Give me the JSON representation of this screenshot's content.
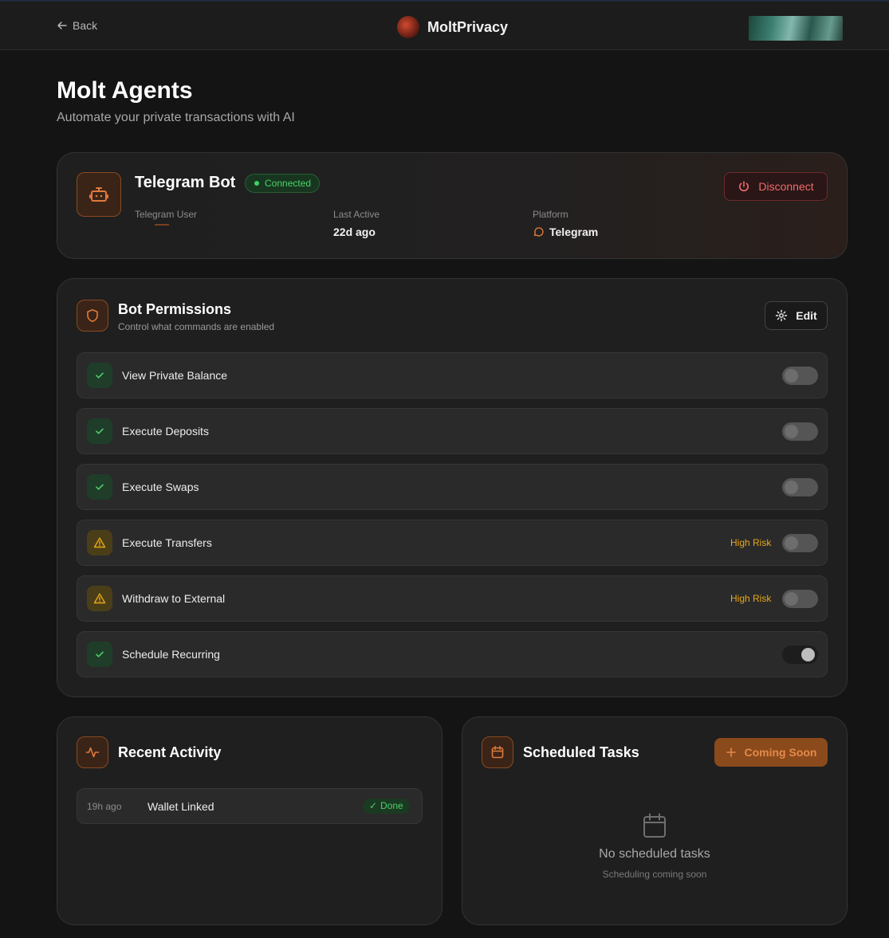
{
  "header": {
    "back_label": "Back",
    "brand": "MoltPrivacy"
  },
  "page": {
    "title": "Molt Agents",
    "subtitle": "Automate your private transactions with AI"
  },
  "bot": {
    "title": "Telegram Bot",
    "status": "Connected",
    "disconnect_label": "Disconnect",
    "user_label": "Telegram User",
    "last_active_label": "Last Active",
    "last_active_value": "22d ago",
    "platform_label": "Platform",
    "platform_value": "Telegram"
  },
  "permissions": {
    "title": "Bot Permissions",
    "subtitle": "Control what commands are enabled",
    "edit_label": "Edit",
    "items": [
      {
        "label": "View Private Balance",
        "risk": "",
        "enabled": false,
        "kind": "ok"
      },
      {
        "label": "Execute Deposits",
        "risk": "",
        "enabled": false,
        "kind": "ok"
      },
      {
        "label": "Execute Swaps",
        "risk": "",
        "enabled": false,
        "kind": "ok"
      },
      {
        "label": "Execute Transfers",
        "risk": "High Risk",
        "enabled": false,
        "kind": "warn"
      },
      {
        "label": "Withdraw to External",
        "risk": "High Risk",
        "enabled": false,
        "kind": "warn"
      },
      {
        "label": "Schedule Recurring",
        "risk": "",
        "enabled": true,
        "kind": "ok"
      }
    ]
  },
  "activity": {
    "title": "Recent Activity",
    "items": [
      {
        "time": "19h ago",
        "label": "Wallet Linked",
        "status": "Done"
      }
    ]
  },
  "tasks": {
    "title": "Scheduled Tasks",
    "button_label": "Coming Soon",
    "empty_title": "No scheduled tasks",
    "empty_subtitle": "Scheduling coming soon"
  },
  "colors": {
    "accent": "#e07a3a",
    "success": "#3ed162",
    "danger": "#f06a6a",
    "warning": "#e6a817"
  }
}
